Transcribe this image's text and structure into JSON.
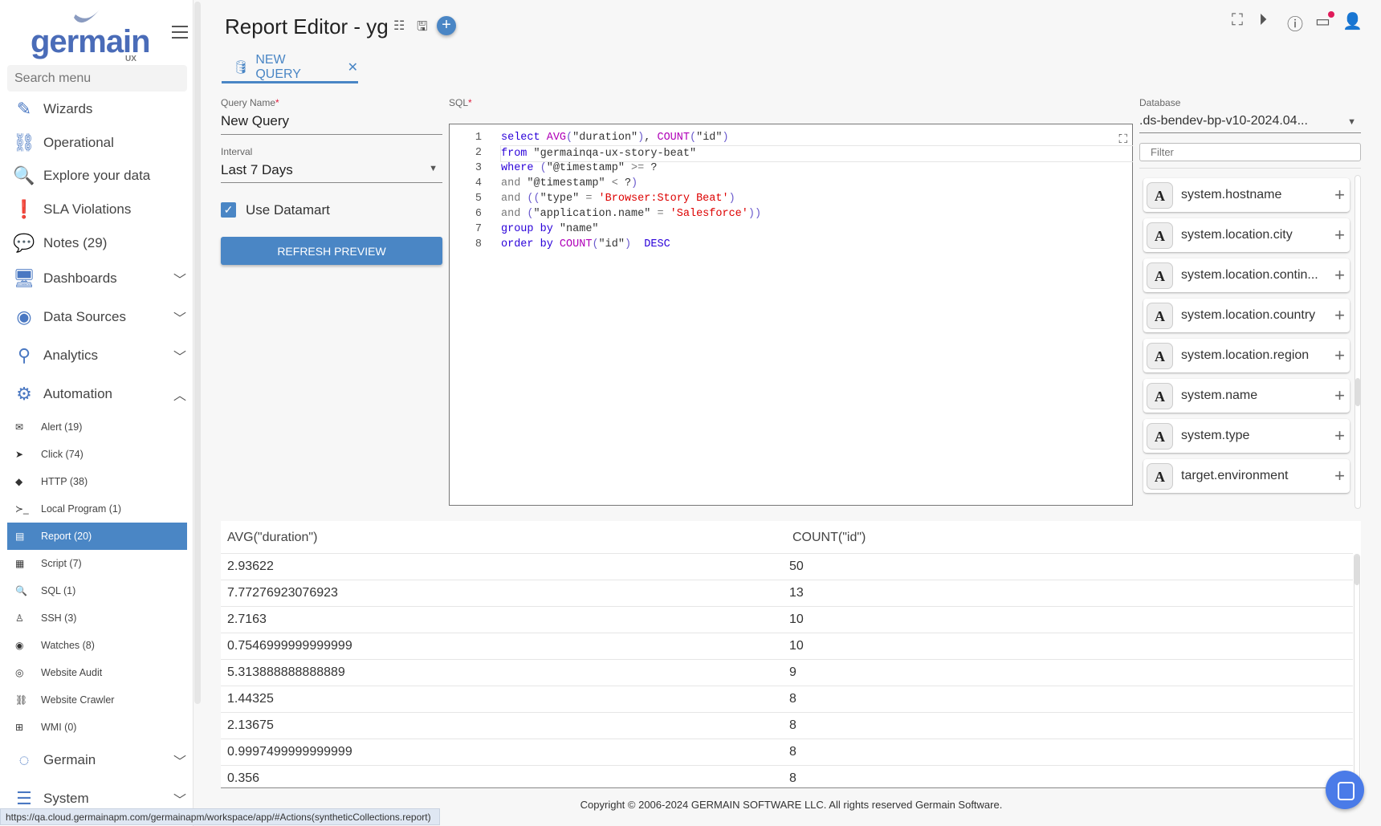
{
  "brand": {
    "name": "germain",
    "sub": "UX"
  },
  "sidebar": {
    "search_placeholder": "Search menu",
    "items": [
      {
        "label": "Wizards",
        "icon": "pencil-icon"
      },
      {
        "label": "Operational",
        "icon": "sitemap-icon"
      },
      {
        "label": "Explore your data",
        "icon": "search-icon"
      },
      {
        "label": "SLA Violations",
        "icon": "exclamation-circle-icon"
      },
      {
        "label": "Notes (29)",
        "icon": "chat-icon"
      },
      {
        "label": "Dashboards",
        "icon": "dashboard-icon"
      },
      {
        "label": "Data Sources",
        "icon": "database-icon"
      },
      {
        "label": "Analytics",
        "icon": "analytics-icon"
      },
      {
        "label": "Automation",
        "icon": "gear-icon"
      }
    ],
    "automation_items": [
      {
        "label": "Alert (19)",
        "icon": "envelope-icon"
      },
      {
        "label": "Click (74)",
        "icon": "cursor-icon"
      },
      {
        "label": "HTTP (38)",
        "icon": "diamond-arrow-icon"
      },
      {
        "label": "Local Program (1)",
        "icon": "terminal-icon"
      },
      {
        "label": "Report (20)",
        "icon": "file-icon",
        "active": true
      },
      {
        "label": "Script (7)",
        "icon": "file-code-icon"
      },
      {
        "label": "SQL (1)",
        "icon": "search-icon"
      },
      {
        "label": "SSH (3)",
        "icon": "linux-icon"
      },
      {
        "label": "Watches (8)",
        "icon": "eye-icon"
      },
      {
        "label": "Website Audit",
        "icon": "check-circle-icon"
      },
      {
        "label": "Website Crawler",
        "icon": "sitemap-icon"
      },
      {
        "label": "WMI (0)",
        "icon": "windows-icon"
      }
    ],
    "bottom_items": [
      {
        "label": "Germain",
        "icon": "germain-circle-icon"
      },
      {
        "label": "System",
        "icon": "sliders-icon"
      }
    ]
  },
  "header": {
    "title": "Report Editor - yg"
  },
  "tab": {
    "label": "NEW QUERY"
  },
  "form": {
    "query_name_label": "Query Name",
    "query_name_value": "New Query",
    "interval_label": "Interval",
    "interval_value": "Last 7 Days",
    "use_datamart_label": "Use Datamart",
    "use_datamart_checked": true,
    "refresh_label": "REFRESH PREVIEW",
    "required_mark": "*"
  },
  "sql": {
    "label": "SQL",
    "lines": [
      [
        [
          "kw",
          "select "
        ],
        [
          "fn",
          "AVG"
        ],
        [
          "pn",
          "("
        ],
        [
          "",
          "\"duration\""
        ],
        [
          "pn",
          ")"
        ],
        [
          "",
          ", "
        ],
        [
          "fn",
          "COUNT"
        ],
        [
          "pn",
          "("
        ],
        [
          "",
          "\"id\""
        ],
        [
          "pn",
          ")"
        ]
      ],
      [
        [
          "kw",
          "from "
        ],
        [
          "",
          "\"germainqa-ux-story-beat\""
        ]
      ],
      [
        [
          "kw",
          "where "
        ],
        [
          "pn",
          "("
        ],
        [
          "",
          "\"@timestamp\" "
        ],
        [
          "op",
          ">="
        ],
        [
          "",
          " ?"
        ]
      ],
      [
        [
          "op",
          "and "
        ],
        [
          "",
          "\"@timestamp\" "
        ],
        [
          "op",
          "<"
        ],
        [
          "",
          " ?"
        ],
        [
          "pn",
          ")"
        ]
      ],
      [
        [
          "op",
          "and "
        ],
        [
          "pn",
          "(("
        ],
        [
          "",
          "\"type\" "
        ],
        [
          "op",
          "="
        ],
        [
          "",
          " "
        ],
        [
          "str",
          "'Browser:Story Beat'"
        ],
        [
          "pn",
          ")"
        ]
      ],
      [
        [
          "op",
          "and "
        ],
        [
          "pn",
          "("
        ],
        [
          "",
          "\"application.name\" "
        ],
        [
          "op",
          "="
        ],
        [
          "",
          " "
        ],
        [
          "str",
          "'Salesforce'"
        ],
        [
          "pn",
          "))"
        ]
      ],
      [
        [
          "kw",
          "group by "
        ],
        [
          "",
          "\"name\""
        ]
      ],
      [
        [
          "kw",
          "order by "
        ],
        [
          "fn",
          "COUNT"
        ],
        [
          "pn",
          "("
        ],
        [
          "",
          "\"id\""
        ],
        [
          "pn",
          ")"
        ],
        [
          "",
          "  "
        ],
        [
          "kw",
          "DESC"
        ]
      ]
    ]
  },
  "database": {
    "label": "Database",
    "value": ".ds-bendev-bp-v10-2024.04...",
    "filter_placeholder": "Filter",
    "fields": [
      "system.hostname",
      "system.location.city",
      "system.location.contin...",
      "system.location.country",
      "system.location.region",
      "system.name",
      "system.type",
      "target.environment"
    ]
  },
  "table": {
    "columns": [
      "AVG(\"duration\")",
      "COUNT(\"id\")"
    ],
    "rows": [
      [
        "2.93622",
        "50"
      ],
      [
        "7.77276923076923",
        "13"
      ],
      [
        "2.7163",
        "10"
      ],
      [
        "0.7546999999999999",
        "10"
      ],
      [
        "5.313888888888889",
        "9"
      ],
      [
        "1.44325",
        "8"
      ],
      [
        "2.13675",
        "8"
      ],
      [
        "0.9997499999999999",
        "8"
      ],
      [
        "0.356",
        "8"
      ]
    ]
  },
  "footer": {
    "copyright": "Copyright © 2006-2024 GERMAIN SOFTWARE LLC. All rights reserved Germain Software."
  },
  "status_url": "https://qa.cloud.germainapm.com/germainapm/workspace/app/#Actions(syntheticCollections.report)",
  "colors": {
    "accent": "#4a86c5",
    "notification": "#e01b5a"
  }
}
